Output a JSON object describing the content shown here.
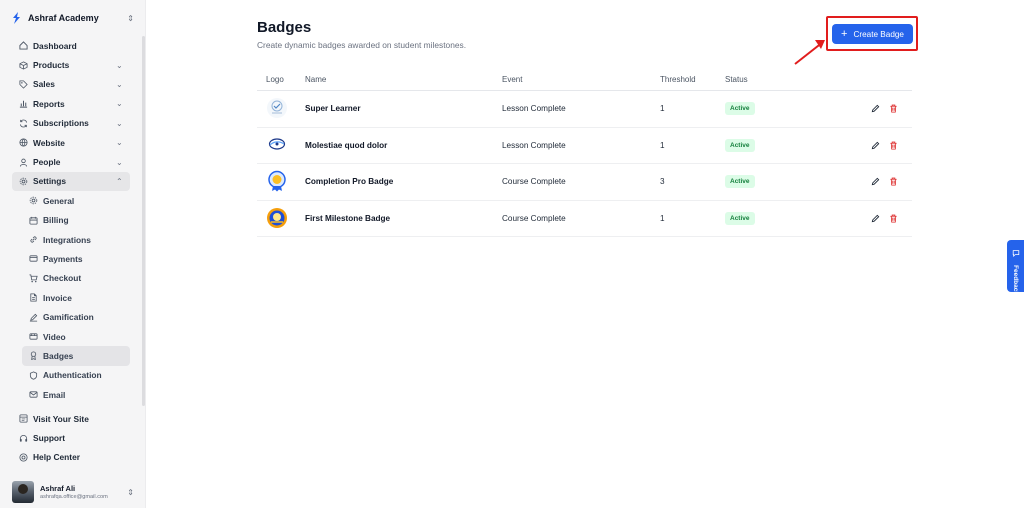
{
  "app": {
    "name": "Ashraf Academy"
  },
  "sidebar": {
    "items": [
      {
        "label": "Dashboard",
        "icon": "home-icon",
        "chevron": false
      },
      {
        "label": "Products",
        "icon": "box-icon",
        "chevron": true
      },
      {
        "label": "Sales",
        "icon": "tag-icon",
        "chevron": true
      },
      {
        "label": "Reports",
        "icon": "bar-chart-icon",
        "chevron": true
      },
      {
        "label": "Subscriptions",
        "icon": "refresh-icon",
        "chevron": true
      },
      {
        "label": "Website",
        "icon": "globe-icon",
        "chevron": true
      },
      {
        "label": "People",
        "icon": "user-icon",
        "chevron": true
      },
      {
        "label": "Settings",
        "icon": "gear-icon",
        "chevron": true
      }
    ],
    "settings_sub": [
      {
        "label": "General",
        "icon": "gear-icon"
      },
      {
        "label": "Billing",
        "icon": "calendar-icon"
      },
      {
        "label": "Integrations",
        "icon": "link-icon"
      },
      {
        "label": "Payments",
        "icon": "credit-card-icon"
      },
      {
        "label": "Checkout",
        "icon": "cart-icon"
      },
      {
        "label": "Invoice",
        "icon": "file-icon"
      },
      {
        "label": "Gamification",
        "icon": "pen-icon"
      },
      {
        "label": "Video",
        "icon": "video-icon"
      },
      {
        "label": "Badges",
        "icon": "medal-icon"
      },
      {
        "label": "Authentication",
        "icon": "shield-icon"
      },
      {
        "label": "Email",
        "icon": "mail-icon"
      }
    ],
    "bottom": [
      {
        "label": "Visit Your Site",
        "icon": "external-site-icon"
      },
      {
        "label": "Support",
        "icon": "headset-icon"
      },
      {
        "label": "Help Center",
        "icon": "lifebuoy-icon"
      }
    ],
    "user": {
      "name": "Ashraf Ali",
      "email": "ashrafqa.office@gmail.com"
    }
  },
  "page": {
    "title": "Badges",
    "subtitle": "Create dynamic badges awarded on student milestones.",
    "create_button": "Create Badge"
  },
  "table": {
    "headers": {
      "logo": "Logo",
      "name": "Name",
      "event": "Event",
      "threshold": "Threshold",
      "status": "Status"
    },
    "rows": [
      {
        "name": "Super Learner",
        "event": "Lesson Complete",
        "threshold": "1",
        "status": "Active"
      },
      {
        "name": "Molestiae quod dolor",
        "event": "Lesson Complete",
        "threshold": "1",
        "status": "Active"
      },
      {
        "name": "Completion Pro Badge",
        "event": "Course Complete",
        "threshold": "3",
        "status": "Active"
      },
      {
        "name": "First Milestone Badge",
        "event": "Course Complete",
        "threshold": "1",
        "status": "Active"
      }
    ]
  },
  "feedback_tab": "Feedback",
  "colors": {
    "accent": "#2563eb",
    "active_badge_bg": "#dcfce7",
    "active_badge_text": "#15803d",
    "delete": "#dc2626",
    "highlight": "#e11d1d"
  }
}
